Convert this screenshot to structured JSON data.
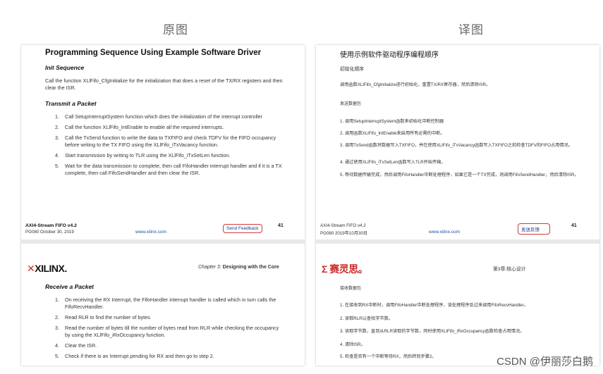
{
  "columns": {
    "left": "原图",
    "right": "译图"
  },
  "left_top": {
    "title": "Programming Sequence Using Example Software Driver",
    "init_heading": "Init Sequence",
    "init_text": "Call the function XLlFifo_CfgInitialize for the initialization that does a reset of the TX/RX registers and then clear the ISR.",
    "tx_heading": "Transmit a Packet",
    "tx_items": [
      "Call SetupInterruptSystem function which does the initialization of the interrupt controller",
      "Call the function XLlFifo_IntEnable to enable all the required interrupts.",
      "Call the TxSend function to write the data to TXFIFO and check TDFV for the FIFO occupancy before writing to the TX FIFO using the XLlFifo_iTxVacancy function.",
      "Start transmission by writing to TLR using the XLlFifo_iTxSetLen function.",
      "Wait for the data transmission to complete, then call FifoHandler interrupt handler and if it is a TX complete, then call FifoSendHandler and then clear the ISR."
    ],
    "footer_product": "AXI4-Stream FIFO v4.2",
    "footer_doc": "PG080 October 30, 2019",
    "footer_link": "www.xilinx.com",
    "feedback": "Send Feedback",
    "page": "41"
  },
  "left_bottom": {
    "logo": "XILINX.",
    "chapter": "Chapter 3:",
    "chapter_title": "Designing with the Core",
    "rx_heading": "Receive a Packet",
    "rx_items": [
      "On receiving the RX Interrupt, the FifoHandler interrupt handler is called which in turn calls the FifoRecvHandler.",
      "Read RLR to find the number of bytes.",
      "Read the number of bytes till the number of bytes read from RLR while checking the occupancy by using the XLlFifo_iRxOccupancy function.",
      "Clear the ISR.",
      "Check if there is an Interrupt pending for RX and then go to step 2."
    ]
  },
  "right_top": {
    "title": "使用示例软件驱动程序编程顺序",
    "init_heading": "初始化顺序",
    "init_text": "调用函数XLlFifo_CfgInitialize进行初始化，重置TX/RX寄存器，然后清除ISR。",
    "tx_heading": "发送数据包",
    "tx_items": [
      "调用SetupInterruptSystem函数来初始化中断控制器",
      "调用函数XLlFifo_IntEnable来启用所有必需的中断。",
      "调用TxSend函数将数据写入TXFIFO，并在使用XLlFifo_iTxVacancy函数写入TXFIFO之前检查TDFV的FIFO占用情况。",
      "通过使用XLlFifo_iTxSetLen函数写入TLR开始传输。",
      "等待数据传输完成，然后调用FifoHandler中断处理程序，如果它是一个TX完成，则调用FifoSendHandler，然后清除ISR。"
    ],
    "footer_product": "AXI4-Stream FIFO v4.2",
    "footer_doc": "PG080 2019年10月30日",
    "footer_link": "www.xilinx.com",
    "feedback": "发送反馈",
    "page": "41"
  },
  "right_bottom": {
    "logo": "Σ 赛灵思。",
    "chapter": "第3章:核心设计",
    "rx_heading": "接收数据包",
    "rx_items": [
      "在接收到RX中断时，调用FifoHandler中断处理程序，该处理程序反过来调用FifoRecvHandler。",
      "读取RLR以查找字节数。",
      "读取字节数，直到从RLR读取的字节数，同时使用XLlFifo_iRxOccupancy函数检查占用情况。",
      "清除ISR。",
      "检查是否有一个中断等待RX，然后转到步骤2。"
    ]
  },
  "watermark": "CSDN @伊丽莎白鹅"
}
